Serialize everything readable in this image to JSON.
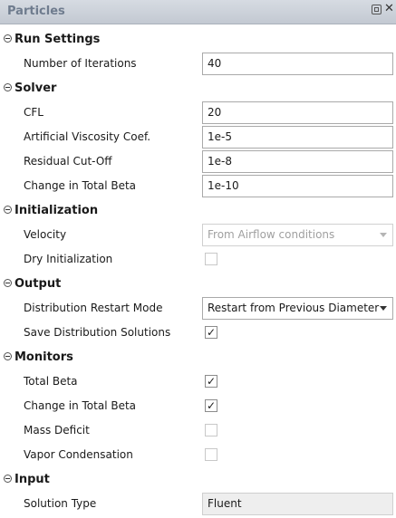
{
  "panel": {
    "title": "Particles"
  },
  "sections": {
    "run_settings": {
      "title": "Run Settings",
      "number_of_iterations": {
        "label": "Number of Iterations",
        "value": "40"
      }
    },
    "solver": {
      "title": "Solver",
      "cfl": {
        "label": "CFL",
        "value": "20"
      },
      "artificial_viscosity": {
        "label": "Artificial Viscosity Coef.",
        "value": "1e-5"
      },
      "residual_cutoff": {
        "label": "Residual Cut-Off",
        "value": "1e-8"
      },
      "change_in_total_beta": {
        "label": "Change in Total Beta",
        "value": "1e-10"
      }
    },
    "initialization": {
      "title": "Initialization",
      "velocity": {
        "label": "Velocity",
        "value": "From Airflow conditions"
      },
      "dry_initialization": {
        "label": "Dry Initialization",
        "checked": false
      }
    },
    "output": {
      "title": "Output",
      "distribution_restart_mode": {
        "label": "Distribution Restart Mode",
        "value": "Restart from Previous Diameter"
      },
      "save_distribution_solutions": {
        "label": "Save Distribution Solutions",
        "checked": true
      }
    },
    "monitors": {
      "title": "Monitors",
      "total_beta": {
        "label": "Total Beta",
        "checked": true
      },
      "change_in_total_beta": {
        "label": "Change in Total Beta",
        "checked": true
      },
      "mass_deficit": {
        "label": "Mass Deficit",
        "checked": false
      },
      "vapor_condensation": {
        "label": "Vapor Condensation",
        "checked": false
      }
    },
    "input": {
      "title": "Input",
      "solution_type": {
        "label": "Solution Type",
        "value": "Fluent"
      }
    }
  },
  "icons": {
    "collapse": "collapse-minus-icon",
    "restore": "restore-icon",
    "close": "close-icon",
    "dropdown": "chevron-down-icon",
    "check": "checkmark-icon"
  }
}
